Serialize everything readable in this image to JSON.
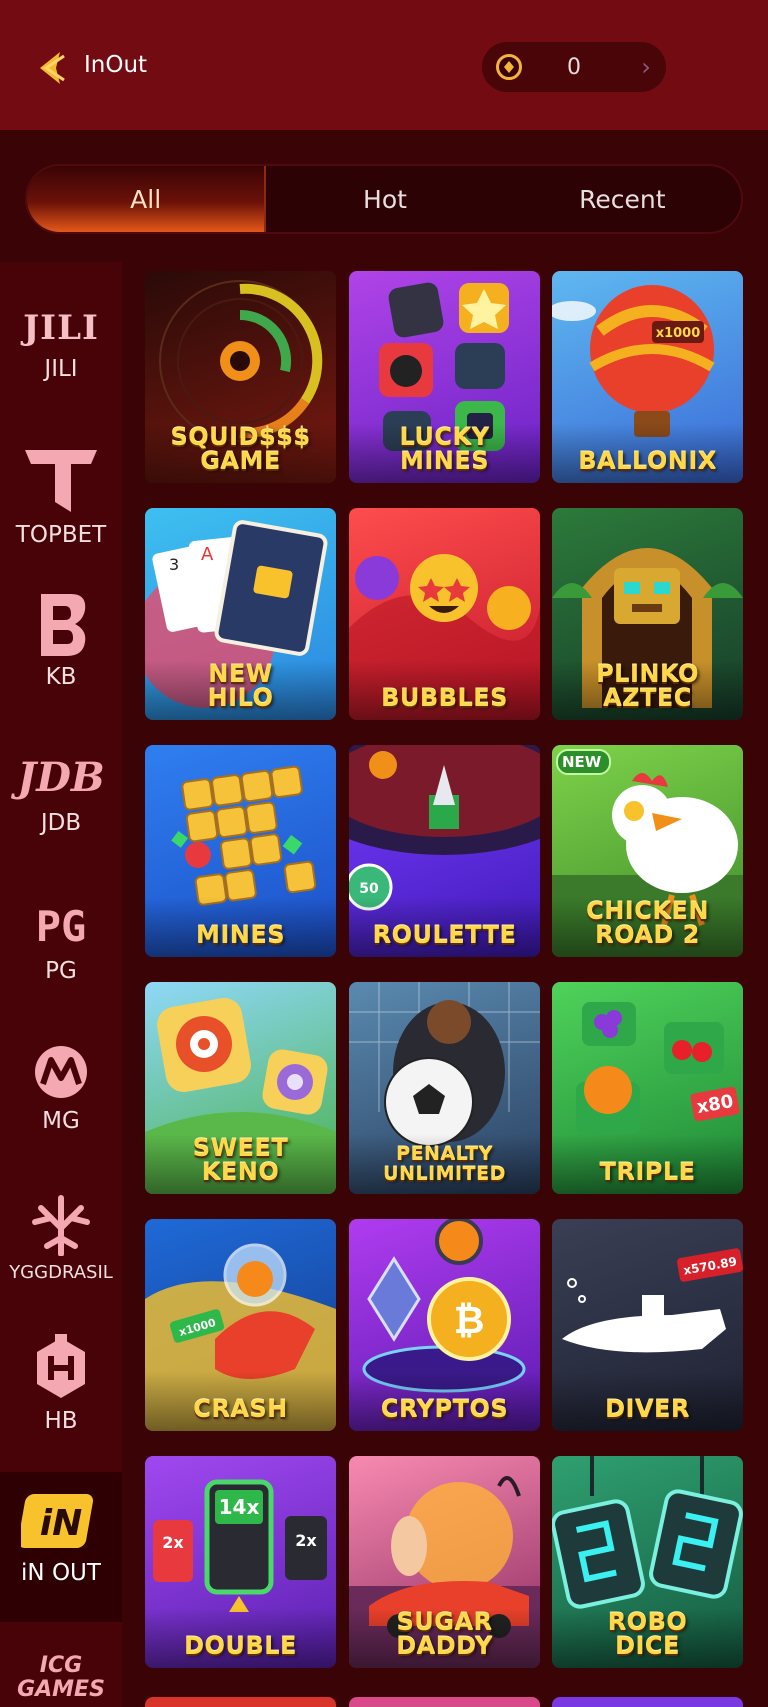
{
  "header": {
    "title": "InOut",
    "balance": "0",
    "colors": {
      "bar": "#730b12",
      "coin": "#f2b43c"
    }
  },
  "tabs": [
    {
      "label": "All",
      "active": true
    },
    {
      "label": "Hot",
      "active": false
    },
    {
      "label": "Recent",
      "active": false
    }
  ],
  "providers": [
    {
      "label": "JILI",
      "logo_text": "JILI",
      "active": false
    },
    {
      "label": "TOPBET",
      "logo_text": "T",
      "active": false
    },
    {
      "label": "KB",
      "logo_text": "B",
      "active": false
    },
    {
      "label": "JDB",
      "logo_text": "JDB",
      "active": false
    },
    {
      "label": "PG",
      "logo_text": "PG",
      "active": false
    },
    {
      "label": "MG",
      "logo_text": "M",
      "active": false
    },
    {
      "label": "YGGDRASIL",
      "logo_text": "",
      "active": false
    },
    {
      "label": "HB",
      "logo_text": "H",
      "active": false
    },
    {
      "label": "iN OUT",
      "logo_text": "iN",
      "active": true
    },
    {
      "label": "",
      "logo_text": "ICG GAMES",
      "active": false
    }
  ],
  "games": [
    {
      "name": "SQUID$$$\nGAME",
      "icon": "dial-gauge",
      "bg": [
        "#2a0a08",
        "#7a1a10"
      ],
      "badge": ""
    },
    {
      "name": "LUCKY\nMINES",
      "icon": "bomb-tiles",
      "bg": [
        "#b044e8",
        "#6a22c6"
      ],
      "badge": ""
    },
    {
      "name": "BALLONIX",
      "icon": "hot-air-balloon",
      "bg": [
        "#5fb8f0",
        "#3a6ad8"
      ],
      "badge": ""
    },
    {
      "name": "NEW\nHILO",
      "icon": "playing-cards",
      "bg": [
        "#3ec0f0",
        "#2a86e0"
      ],
      "badge": ""
    },
    {
      "name": "BUBBLES",
      "icon": "emoji-bubbles",
      "bg": [
        "#ff4d4d",
        "#c0182a"
      ],
      "badge": ""
    },
    {
      "name": "PLINKO\nAZTEC",
      "icon": "aztec-temple",
      "bg": [
        "#2c7a3a",
        "#173d2a"
      ],
      "badge": ""
    },
    {
      "name": "MINES",
      "icon": "question-tiles",
      "bg": [
        "#2f7ff0",
        "#1c4fc8"
      ],
      "badge": ""
    },
    {
      "name": "ROULETTE",
      "icon": "roulette-wheel",
      "bg": [
        "#7a3cff",
        "#3f1ab8"
      ],
      "badge": ""
    },
    {
      "name": "CHICKEN\nROAD 2",
      "icon": "chicken",
      "bg": [
        "#7ed34a",
        "#3c8a2a"
      ],
      "badge": "NEW"
    },
    {
      "name": "SWEET\nKENO",
      "icon": "candy-tiles",
      "bg": [
        "#8fd8f8",
        "#48b04a"
      ],
      "badge": ""
    },
    {
      "name": "PENALTY\nUNLIMITED",
      "icon": "soccer-ball",
      "bg": [
        "#5a8ab0",
        "#2a4060"
      ],
      "badge": ""
    },
    {
      "name": "TRIPLE",
      "icon": "fruit-cherries",
      "bg": [
        "#4fd25a",
        "#1f8a38"
      ],
      "badge": ""
    },
    {
      "name": "CRASH",
      "icon": "rocket-fish",
      "bg": [
        "#1f6ad8",
        "#133a8a"
      ],
      "badge": ""
    },
    {
      "name": "CRYPTOS",
      "icon": "crypto-coins",
      "bg": [
        "#b03cf0",
        "#5a1ab0"
      ],
      "badge": ""
    },
    {
      "name": "DIVER",
      "icon": "submarine",
      "bg": [
        "#3a3f55",
        "#1f2233"
      ],
      "badge": ""
    },
    {
      "name": "DOUBLE",
      "icon": "multiplier-blocks",
      "bg": [
        "#a048f0",
        "#5a20b0"
      ],
      "badge": ""
    },
    {
      "name": "SUGAR\nDADDY",
      "icon": "sunset-car",
      "bg": [
        "#f88ab0",
        "#8a2a60"
      ],
      "badge": ""
    },
    {
      "name": "ROBO\nDICE",
      "icon": "digital-dice",
      "bg": [
        "#2fa070",
        "#145a40"
      ],
      "badge": ""
    }
  ],
  "tile_texts": {
    "roulette_badge": "50",
    "triple_mult": "x80",
    "crash_mult": "x1000",
    "diver_mult": "x570.89",
    "ballon_mult": "x1000",
    "double_center": "14x",
    "double_left": "2x",
    "double_right": "2x"
  }
}
